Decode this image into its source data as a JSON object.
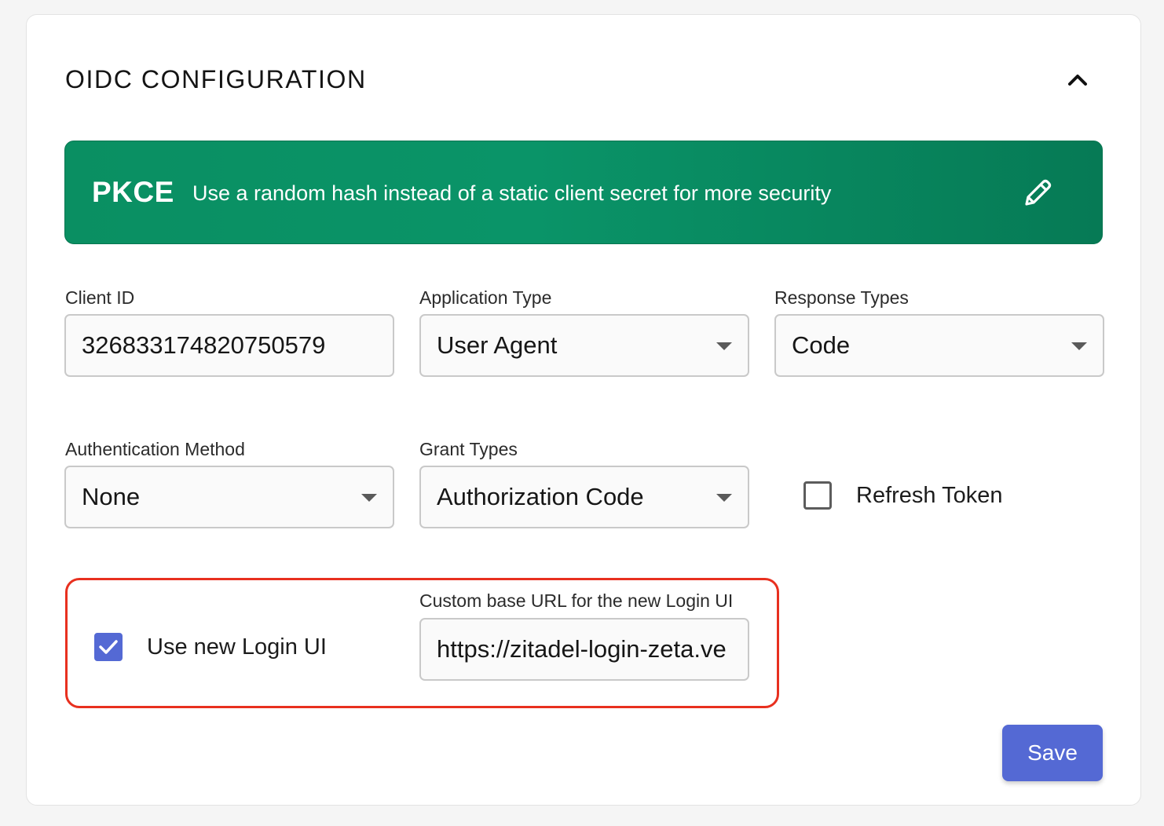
{
  "section": {
    "title": "OIDC CONFIGURATION",
    "collapse_icon": "chevron-up-icon"
  },
  "banner": {
    "title": "PKCE",
    "description": "Use a random hash instead of a static client secret for more security",
    "edit_icon": "pencil-icon",
    "color": "#0a9468"
  },
  "client_id": {
    "label": "Client ID",
    "value": "326833174820750579"
  },
  "application_type": {
    "label": "Application Type",
    "value": "User Agent"
  },
  "response_types": {
    "label": "Response Types",
    "value": "Code"
  },
  "authentication_method": {
    "label": "Authentication Method",
    "value": "None"
  },
  "grant_types": {
    "label": "Grant Types",
    "value": "Authorization Code"
  },
  "refresh_token": {
    "label": "Refresh Token",
    "checked": false
  },
  "login_ui": {
    "checkbox_label": "Use new Login UI",
    "checked": true,
    "url_label": "Custom base URL for the new Login UI",
    "url_value": "https://zitadel-login-zeta.ve",
    "highlight_color": "#e8301f"
  },
  "actions": {
    "save_label": "Save",
    "accent": "#5469d4"
  }
}
